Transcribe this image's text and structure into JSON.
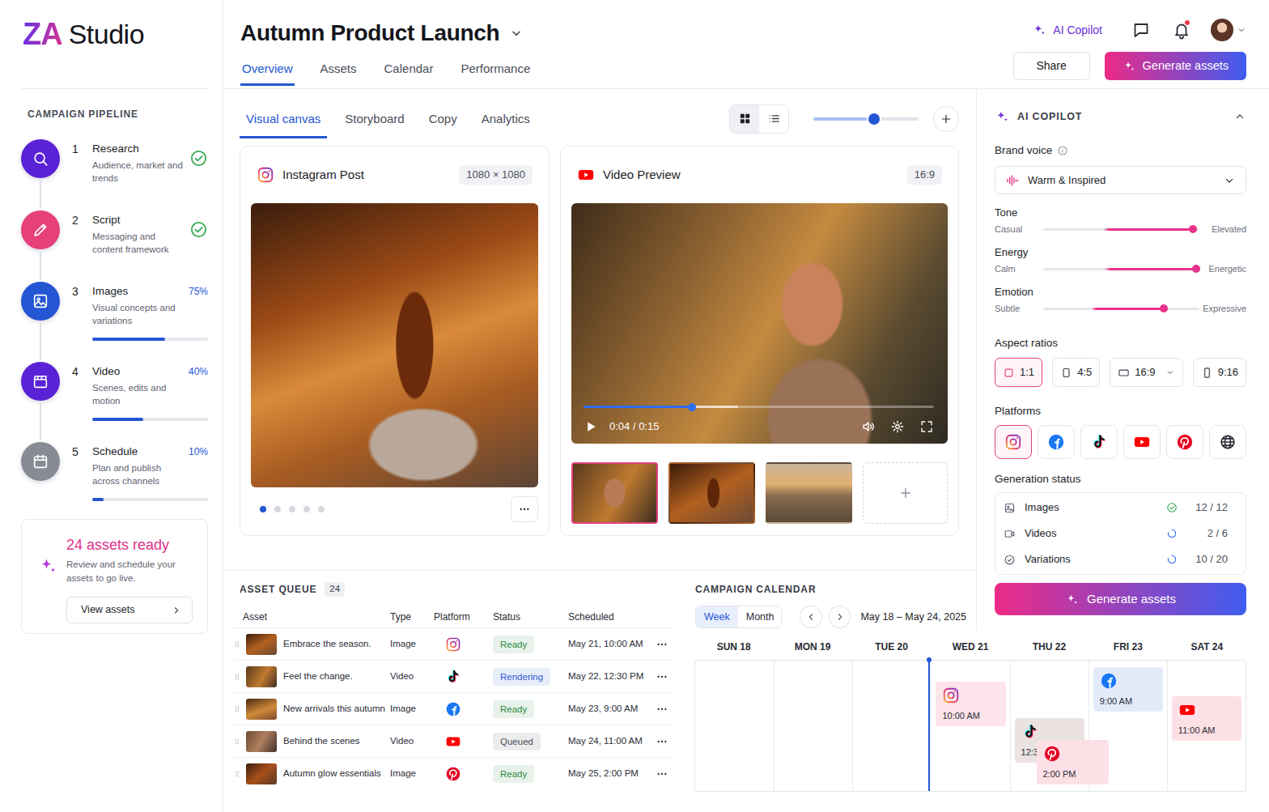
{
  "brand": {
    "mark": "ZA",
    "name": "Studio"
  },
  "header": {
    "title": "Autumn Product Launch",
    "tabs": [
      {
        "label": "Overview",
        "selected": true
      },
      {
        "label": "Assets",
        "selected": false
      },
      {
        "label": "Calendar",
        "selected": false
      },
      {
        "label": "Performance",
        "selected": false
      }
    ],
    "copilot_link": "AI Copilot",
    "notifications_unread": true,
    "share": "Share",
    "generate": "Generate assets"
  },
  "pipeline": {
    "title": "CAMPAIGN PIPELINE",
    "steps": [
      {
        "number": "1",
        "title": "Research",
        "description": "Audience, market and trends",
        "kind": "research",
        "done": true,
        "color": "#5a22d6"
      },
      {
        "number": "2",
        "title": "Script",
        "description": "Messaging and content framework",
        "kind": "script",
        "done": true,
        "color": "#e6407a"
      },
      {
        "number": "3",
        "title": "Images",
        "description": "Visual concepts and variations",
        "kind": "images",
        "done": false,
        "percent": "75%",
        "level": 0.63,
        "color": "#2456d3"
      },
      {
        "number": "4",
        "title": "Video",
        "description": "Scenes, edits and motion",
        "kind": "video",
        "done": false,
        "percent": "40%",
        "level": 0.44,
        "color": "#5a22d6"
      },
      {
        "number": "5",
        "title": "Schedule",
        "description": "Plan and publish across channels",
        "kind": "schedule",
        "done": false,
        "percent": "10%",
        "level": 0.1,
        "color": "#868b94"
      }
    ]
  },
  "ready": {
    "title": "24 assets ready",
    "text": "Review and schedule your assets to go live.",
    "button": "View assets"
  },
  "canvas": {
    "tabs": [
      {
        "label": "Visual canvas",
        "selected": true
      },
      {
        "label": "Storyboard",
        "selected": false
      },
      {
        "label": "Copy",
        "selected": false
      },
      {
        "label": "Analytics",
        "selected": false
      }
    ],
    "views": [
      {
        "kind": "grid",
        "selected": true
      },
      {
        "kind": "list",
        "selected": false
      }
    ],
    "zoom": {
      "level": 0.58
    },
    "instagram": {
      "title": "Instagram Post",
      "size": "1080 × 1080",
      "slides": [
        {
          "selected": true
        },
        {
          "selected": false
        },
        {
          "selected": false
        },
        {
          "selected": false
        },
        {
          "selected": false
        }
      ]
    },
    "video": {
      "title": "Video Preview",
      "ratio": "16:9",
      "playing": false,
      "time": "0:04 / 0:15",
      "progress": 0.31,
      "buffered": 0.44,
      "thumbnails": [
        {
          "selected": true
        },
        {
          "selected": false
        },
        {
          "selected": false
        }
      ]
    }
  },
  "copilot": {
    "title": "AI COPILOT",
    "expanded": true,
    "brand_voice": {
      "label": "Brand voice",
      "value": "Warm & Inspired"
    },
    "sliders": [
      {
        "label": "Tone",
        "min": "Casual",
        "max": "Elevated",
        "level": 0.96
      },
      {
        "label": "Energy",
        "min": "Calm",
        "max": "Energetic",
        "level": 0.98
      },
      {
        "label": "Emotion",
        "min": "Subtle",
        "max": "Expressive",
        "level": 0.77
      }
    ],
    "aspect_ratios": {
      "label": "Aspect ratios",
      "items": [
        {
          "label": "1:1",
          "kind": "square",
          "has_menu": false,
          "selected": true
        },
        {
          "label": "4:5",
          "kind": "portrait",
          "has_menu": false,
          "selected": false
        },
        {
          "label": "16:9",
          "kind": "landscape",
          "has_menu": true,
          "selected": false
        },
        {
          "label": "9:16",
          "kind": "tall",
          "has_menu": false,
          "selected": false
        }
      ]
    },
    "platforms": {
      "label": "Platforms",
      "items": [
        {
          "kind": "instagram",
          "selected": true
        },
        {
          "kind": "facebook",
          "selected": false
        },
        {
          "kind": "tiktok",
          "selected": false
        },
        {
          "kind": "youtube",
          "selected": false
        },
        {
          "kind": "pinterest",
          "selected": false
        },
        {
          "kind": "web",
          "selected": false
        }
      ]
    },
    "generation": {
      "label": "Generation status",
      "items": [
        {
          "label": "Images",
          "kind": "images",
          "done": true,
          "count": "12 / 12"
        },
        {
          "label": "Videos",
          "kind": "videos",
          "done": false,
          "count": "2 / 6"
        },
        {
          "label": "Variations",
          "kind": "variations",
          "done": false,
          "count": "10 / 20"
        }
      ]
    },
    "generate": "Generate assets"
  },
  "queue": {
    "title": "ASSET QUEUE",
    "count": "24",
    "columns": [
      "Asset",
      "Type",
      "Platform",
      "Status",
      "Scheduled"
    ],
    "rows": [
      {
        "asset": "Embrace the season.",
        "type": "Image",
        "kind": "instagram",
        "status": "Ready",
        "color": "#2b8a3e",
        "scheduled": "May 21, 10:00 AM"
      },
      {
        "asset": "Feel the change.",
        "type": "Video",
        "kind": "tiktok",
        "status": "Rendering",
        "color": "#2f5bd3",
        "scheduled": "May 22, 12:30 PM"
      },
      {
        "asset": "New arrivals this autumn",
        "type": "Image",
        "kind": "facebook",
        "status": "Ready",
        "color": "#2b8a3e",
        "scheduled": "May 23, 9:00 AM"
      },
      {
        "asset": "Behind the scenes",
        "type": "Video",
        "kind": "youtube",
        "status": "Queued",
        "color": "#4b4e5a",
        "scheduled": "May 24, 11:00 AM"
      },
      {
        "asset": "Autumn glow essentials",
        "type": "Image",
        "kind": "pinterest",
        "status": "Ready",
        "color": "#2b8a3e",
        "scheduled": "May 25, 2:00 PM"
      }
    ]
  },
  "calendar": {
    "title": "CAMPAIGN CALENDAR",
    "views": [
      {
        "label": "Week",
        "selected": true
      },
      {
        "label": "Month",
        "selected": false
      }
    ],
    "range": "May 18 – May 24, 2025",
    "days": [
      {
        "label": "SUN 18",
        "today": false,
        "events": []
      },
      {
        "label": "MON 19",
        "today": false,
        "events": []
      },
      {
        "label": "TUE 20",
        "today": false,
        "events": []
      },
      {
        "label": "WED 21",
        "today": true,
        "events": [
          {
            "kind": "instagram",
            "time": "10:00 AM",
            "color": "#fde3ea"
          }
        ]
      },
      {
        "label": "THU 22",
        "today": false,
        "events": [
          {
            "kind": "tiktok",
            "time": "12:30 PM",
            "color": "#ebe3e1"
          },
          {
            "kind": "pinterest",
            "time": "2:00 PM",
            "color": "#fde0e6"
          }
        ]
      },
      {
        "label": "FRI 23",
        "today": false,
        "events": [
          {
            "kind": "facebook",
            "time": "9:00 AM",
            "color": "#e3ebfb"
          }
        ]
      },
      {
        "label": "SAT 24",
        "today": false,
        "events": [
          {
            "kind": "youtube",
            "time": "11:00 AM",
            "color": "#fde0e5"
          }
        ]
      }
    ]
  }
}
